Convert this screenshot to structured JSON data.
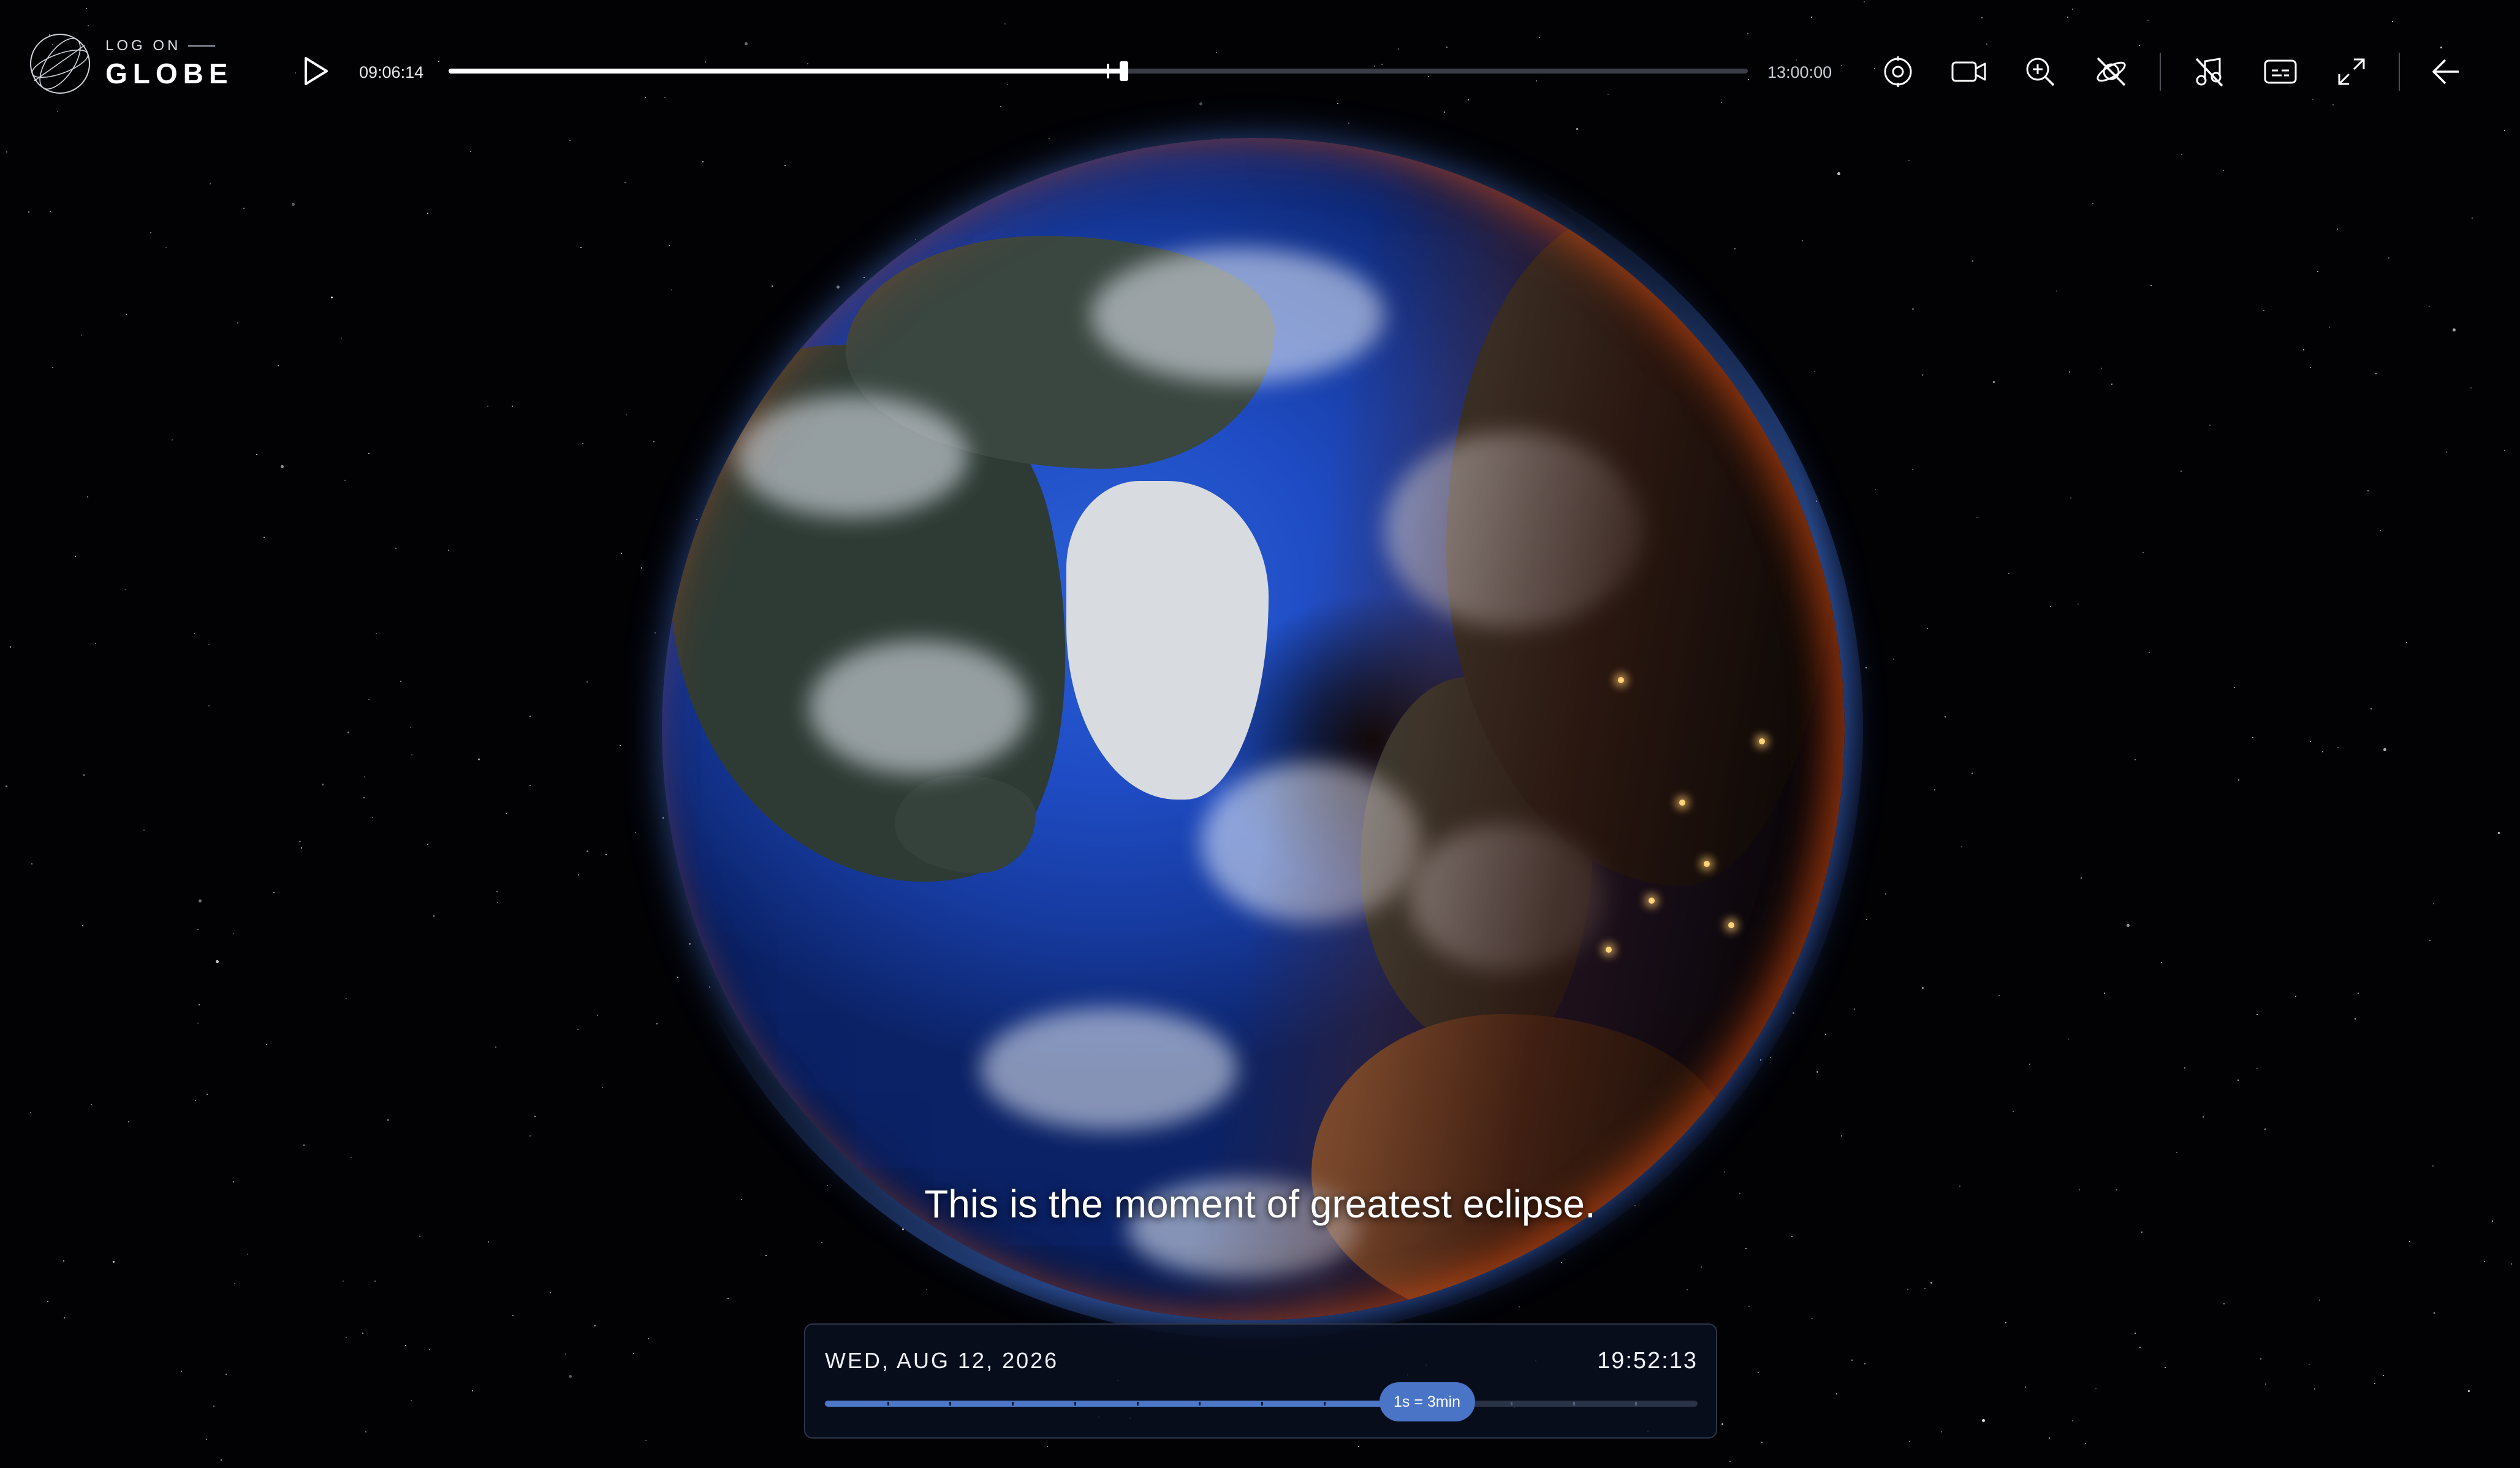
{
  "app": {
    "logo_small": "LOG ON",
    "logo_big": "GLOBE"
  },
  "player": {
    "current_time": "09:06:14",
    "end_time": "13:00:00",
    "progress_fraction": 0.52,
    "accent_color": "#ffffff"
  },
  "toolbar": {
    "icons": [
      "target-icon",
      "video-camera-icon",
      "zoom-in-icon",
      "satellite-off-icon",
      "music-off-icon",
      "captions-icon",
      "fullscreen-icon",
      "back-arrow-icon"
    ]
  },
  "subtitle": "This is the moment of greatest eclipse.",
  "timeline": {
    "date": "WED, AUG 12, 2026",
    "time": "19:52:13",
    "speed_label": "1s = 3min",
    "progress_fraction": 0.69,
    "accent_color": "#4a74c6"
  }
}
